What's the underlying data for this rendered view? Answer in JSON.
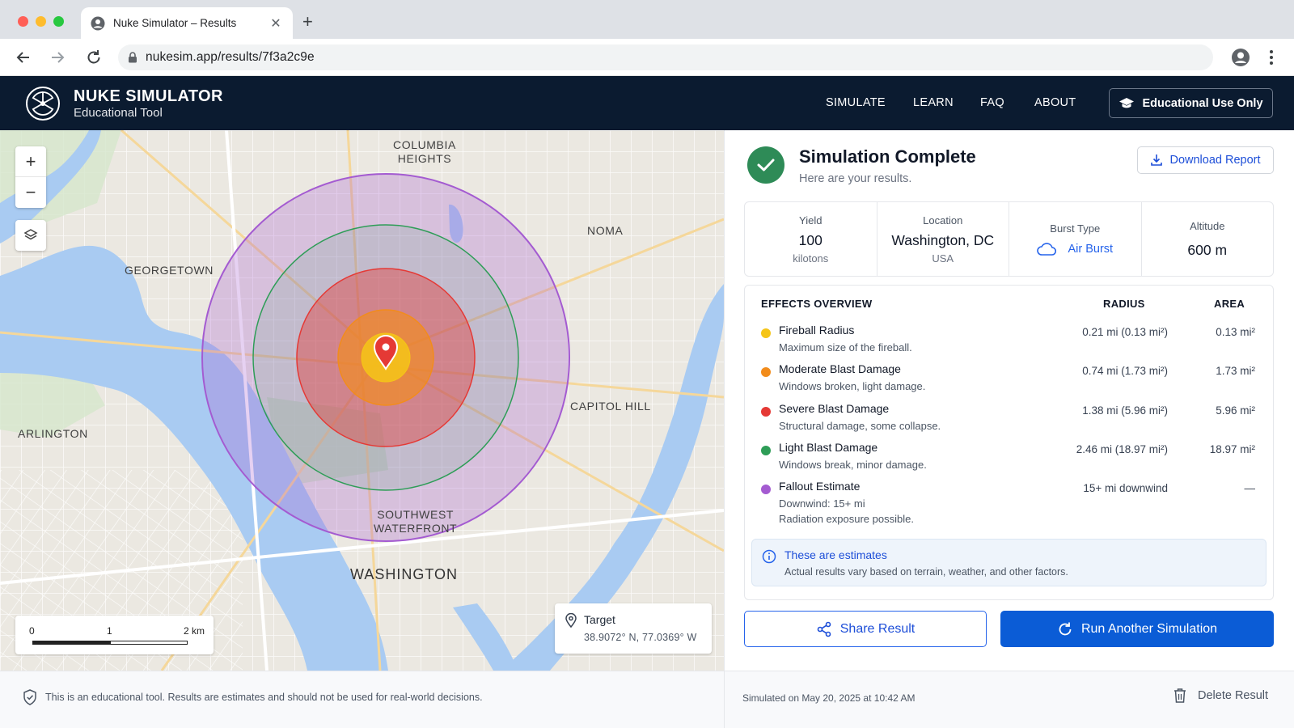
{
  "browser": {
    "tab_title": "Nuke Simulator – Results",
    "tab_close": "✕",
    "new_tab": "+",
    "url": "nukesim.app/results/7f3a2c9e"
  },
  "header": {
    "title": "NUKE SIMULATOR",
    "subtitle": "Educational Tool",
    "nav": [
      "SIMULATE",
      "LEARN",
      "FAQ",
      "ABOUT"
    ],
    "edu_button": "Educational Use Only"
  },
  "map": {
    "labels": {
      "columbia": "COLUMBIA\nHEIGHTS",
      "noma": "NOMA",
      "georgetown": "GEORGETOWN",
      "capitol": "CAPITOL HILL",
      "arlington": "ARLINGTON",
      "southwest": "SOUTHWEST\nWATERFRONT",
      "washington": "WASHINGTON"
    },
    "zoom_in": "+",
    "zoom_out": "−",
    "scale": {
      "t0": "0",
      "t1": "1",
      "t2": "2 km"
    },
    "target": {
      "title": "Target",
      "coords": "38.9072° N, 77.0369° W"
    }
  },
  "results": {
    "title": "Simulation Complete",
    "subtitle": "Here are your results.",
    "download": "Download Report",
    "stats": {
      "yield_label": "Yield",
      "yield_value": "100",
      "yield_unit": "kilotons",
      "location_label": "Location",
      "location_value": "Washington, DC",
      "location_sub": "USA",
      "burst_label": "Burst Type",
      "burst_value": "Air Burst",
      "altitude_label": "Altitude",
      "altitude_value": "600 m"
    },
    "effects_header": {
      "overview": "EFFECTS OVERVIEW",
      "radius": "RADIUS",
      "area": "AREA"
    },
    "effects": [
      {
        "name": "Fireball Radius",
        "desc": "Maximum size of the fireball.",
        "radius": "0.21 mi (0.13 mi²)",
        "area": "0.13 mi²",
        "color": "#f5c518"
      },
      {
        "name": "Moderate Blast Damage",
        "desc": "Windows broken, light damage.",
        "radius": "0.74 mi (1.73 mi²)",
        "area": "1.73 mi²",
        "color": "#f28c1b"
      },
      {
        "name": "Severe Blast Damage",
        "desc": "Structural damage, some collapse.",
        "radius": "1.38 mi (5.96 mi²)",
        "area": "5.96 mi²",
        "color": "#e53935"
      },
      {
        "name": "Light Blast Damage",
        "desc": "Windows break, minor damage.",
        "radius": "2.46 mi (18.97 mi²)",
        "area": "18.97 mi²",
        "color": "#2e9d57"
      },
      {
        "name": "Fallout Estimate",
        "desc": "Downwind: 15+ mi",
        "desc2": "Radiation exposure possible.",
        "radius": "15+ mi downwind",
        "area": "—",
        "color": "#a45bd1"
      }
    ],
    "info_title": "These are estimates",
    "info_text": "Actual results vary based on terrain, weather, and other factors.",
    "share": "Share Result",
    "run_again": "Run Another Simulation"
  },
  "footer": {
    "disclaimer": "This is an educational tool. Results are estimates and should not be used for real-world decisions.",
    "date": "Simulated on May 20, 2025 at 10:42 AM",
    "delete": "Delete Result"
  }
}
